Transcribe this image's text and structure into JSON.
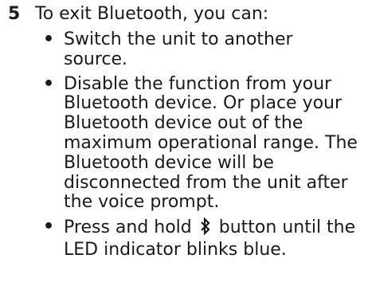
{
  "step": {
    "number": "5",
    "intro": "To exit Bluetooth, you can:",
    "bullets": [
      {
        "marker": "•",
        "text": "Switch the unit to another source."
      },
      {
        "marker": "•",
        "text": "Disable the function from your Bluetooth device. Or place your Bluetooth device out of the maximum operational range. The Bluetooth device will be disconnected from the unit after the voice prompt."
      },
      {
        "marker": "•",
        "text_before": "Press and hold",
        "icon": "bluetooth-icon",
        "text_after": "button until the LED indicator blinks blue."
      }
    ]
  }
}
